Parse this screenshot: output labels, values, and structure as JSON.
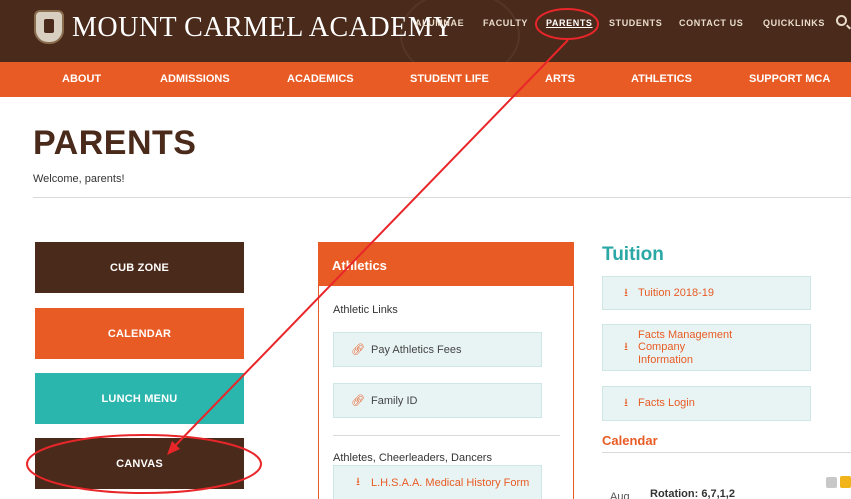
{
  "header": {
    "brand": "MOUNT CARMEL ACADEMY",
    "top_links": [
      "ALUMNAE",
      "FACULTY",
      "PARENTS",
      "STUDENTS",
      "CONTACT US",
      "QUICKLINKS"
    ],
    "active_top_link": "PARENTS"
  },
  "main_nav": [
    "ABOUT",
    "ADMISSIONS",
    "ACADEMICS",
    "STUDENT LIFE",
    "ARTS",
    "ATHLETICS",
    "SUPPORT MCA"
  ],
  "page": {
    "title": "PARENTS",
    "welcome": "Welcome, parents!"
  },
  "left_buttons": [
    "CUB ZONE",
    "CALENDAR",
    "LUNCH MENU",
    "CANVAS"
  ],
  "athletics": {
    "heading": "Athletics",
    "links_heading": "Athletic Links",
    "links": [
      {
        "label": "Pay Athletics Fees",
        "icon": "link-icon"
      },
      {
        "label": "Family ID",
        "icon": "link-icon"
      }
    ],
    "athletes_heading": "Athletes, Cheerleaders, Dancers",
    "forms": [
      {
        "label": "L.H.S.A.A. Medical History Form",
        "icon": "download-icon"
      }
    ]
  },
  "tuition": {
    "heading": "Tuition",
    "links": [
      {
        "label": "Tuition 2018-19",
        "icon": "download-icon"
      },
      {
        "label": "Facts Management Company Information",
        "icon": "download-icon"
      },
      {
        "label": "Facts Login",
        "icon": "download-icon"
      }
    ]
  },
  "calendar": {
    "heading": "Calendar",
    "month": "Aug",
    "rotation": "Rotation: 6,7,1,2"
  },
  "colors": {
    "brown": "#4a2a1a",
    "orange": "#e85b24",
    "teal": "#2ab5ad",
    "annotation_red": "#e8262a"
  }
}
